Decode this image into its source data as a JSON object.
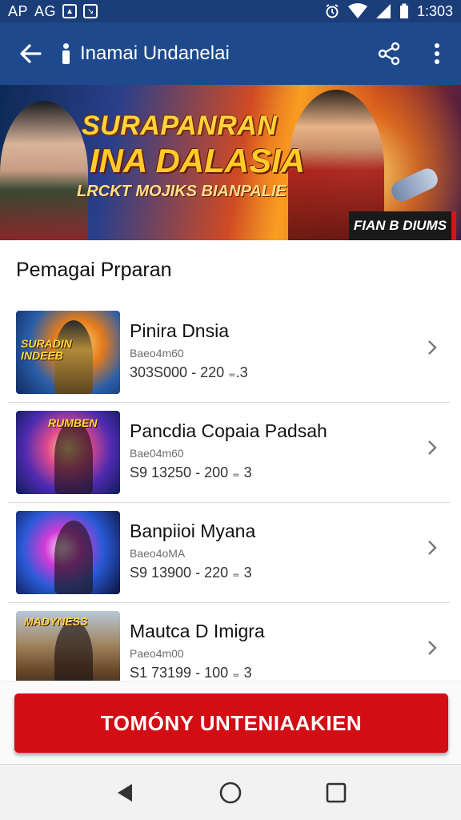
{
  "status_bar": {
    "left_text_1": "AP",
    "left_text_2": "AG",
    "time": "1:303",
    "icons": [
      "alarm-icon",
      "wifi-icon",
      "signal-icon",
      "battery-icon"
    ]
  },
  "app_bar": {
    "title": "Inamai Undanelai",
    "back_icon": "arrow-left-icon",
    "share_icon": "share-icon",
    "menu_icon": "more-vert-icon",
    "color": "#1e4a8d"
  },
  "banner": {
    "line1": "SURAPANRAN",
    "line2": "INA DALASIA",
    "line3": "LRCKT MOJIKS BIANPALIE",
    "tag": "FIAN B DIUMS"
  },
  "section": {
    "title": "Pemagai Prparan"
  },
  "items": [
    {
      "title": "Pinira Dnsia",
      "subtitle": "Baeo4m60",
      "price": "303S000 - 220 ₌.3",
      "thumb_label_1": "SURADIN",
      "thumb_label_2": "INDEEB"
    },
    {
      "title": "Pancdia Copaia Padsah",
      "subtitle": "Bae04m60",
      "price": "S9 13250 - 200 ₌ 3",
      "thumb_label_1": "RUMBEN",
      "thumb_label_2": ""
    },
    {
      "title": "Banpiioi Myana",
      "subtitle": "Baeo4oMA",
      "price": "S9 13900 - 220 ₌ 3",
      "thumb_label_1": "",
      "thumb_label_2": ""
    },
    {
      "title": "Mautca D Imigra",
      "subtitle": "Paeo4m00",
      "price": "S1 73199 - 100 ₌ 3",
      "thumb_label_1": "MADYNESS",
      "thumb_label_2": ""
    }
  ],
  "cta": {
    "label": "TOMÓNY UNTENIAAKIEN",
    "color": "#d20d14"
  },
  "nav": {
    "back_icon": "nav-back-icon",
    "home_icon": "nav-home-icon",
    "recents_icon": "nav-recents-icon"
  }
}
